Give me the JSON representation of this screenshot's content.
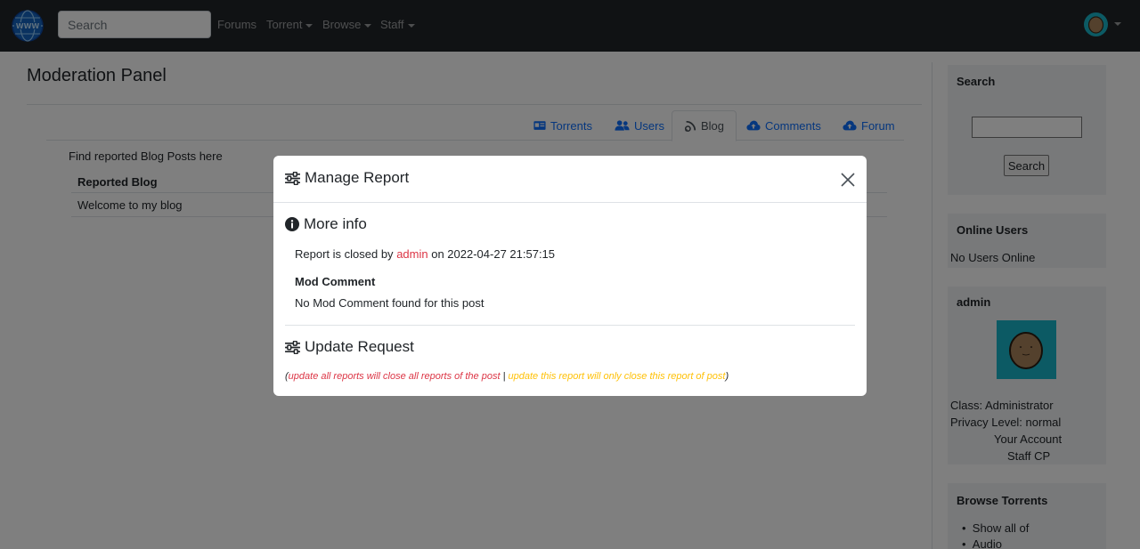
{
  "navbar": {
    "search_placeholder": "Search",
    "links": [
      "Forums",
      "Torrent",
      "Browse",
      "Staff"
    ]
  },
  "main": {
    "title": "Moderation Panel",
    "tabs": [
      {
        "label": "Torrents",
        "icon": "id-card-icon"
      },
      {
        "label": "Users",
        "icon": "users-icon"
      },
      {
        "label": "Blog",
        "icon": "blog-icon",
        "active": true
      },
      {
        "label": "Comments",
        "icon": "cloud-upload-icon"
      },
      {
        "label": "Forum",
        "icon": "cloud-upload-icon"
      }
    ],
    "intro": "Find reported Blog Posts here",
    "table": {
      "header": "Reported Blog",
      "rows": [
        "Welcome to my blog"
      ]
    }
  },
  "sidebar": {
    "search": {
      "title": "Search",
      "button": "Search"
    },
    "online": {
      "title": "Online Users",
      "text": "No Users Online"
    },
    "user": {
      "name": "admin",
      "class": "Class: Administrator",
      "privacy": "Privacy Level: normal",
      "account_link": "Your Account",
      "staff_link": "Staff CP"
    },
    "browse": {
      "title": "Browse Torrents",
      "items": [
        "Show all of",
        "Audio"
      ]
    }
  },
  "modal": {
    "title": "Manage Report",
    "more_info": {
      "title": "More info",
      "closed_prefix": "Report is closed by",
      "closed_user": "admin",
      "closed_suffix": "on 2022-04-27 21:57:15",
      "mod_comment_label": "Mod Comment",
      "mod_comment_text": "No Mod Comment found for this post"
    },
    "update": {
      "title": "Update Request",
      "open_paren": "(",
      "all_text": "update all reports will close all reports of the post",
      "separator": " | ",
      "one_text": "update this report will only close this report of post",
      "close_paren": ")"
    }
  },
  "colors": {
    "navbar": "#212529",
    "link": "#0d6efd",
    "danger": "#dc3545",
    "warning": "#ffc107",
    "avatar_bg": "#19b5c9"
  }
}
